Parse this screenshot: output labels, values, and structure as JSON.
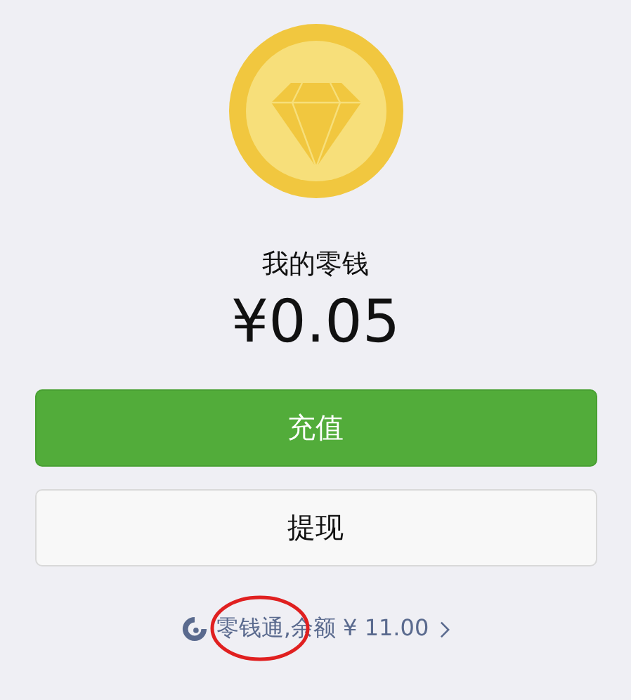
{
  "title": "我的零钱",
  "balance": "¥0.05",
  "buttons": [
    {
      "label": "充值",
      "kind": "primary"
    },
    {
      "label": "提现",
      "kind": "secondary"
    }
  ],
  "footer_link": {
    "text": "零钱通,余额 ¥ 11.00"
  }
}
